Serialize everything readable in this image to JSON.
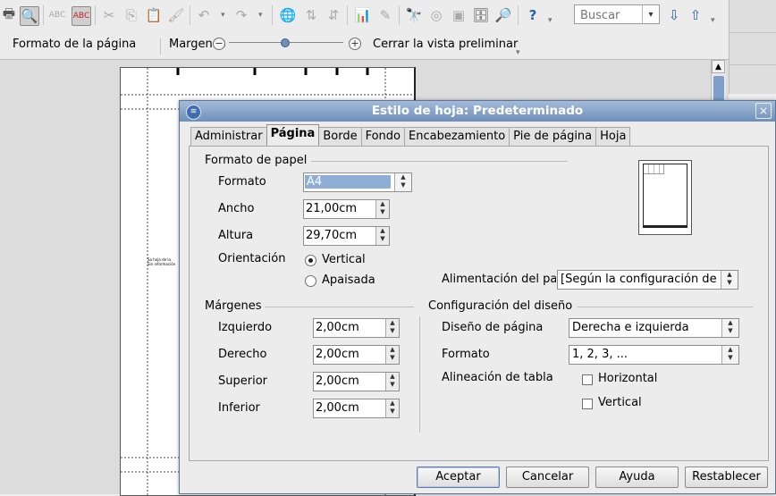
{
  "toolbar": {
    "search_placeholder": "Buscar",
    "icons": [
      "printer-icon",
      "print-preview-icon",
      "spellcheck-icon",
      "autospellcheck-icon",
      "cut-icon",
      "copy-icon",
      "paste-icon",
      "clone-format-icon",
      "undo-icon",
      "redo-icon",
      "hyperlink-icon",
      "sort-ascending-icon",
      "sort-descending-icon",
      "chart-icon",
      "draw-functions-icon",
      "find-replace-icon",
      "navigator-icon",
      "gallery-icon",
      "data-sources-icon",
      "zoom-icon",
      "help-icon",
      "find-next-icon",
      "find-previous-icon"
    ]
  },
  "preview_bar": {
    "format_page": "Formato de la página",
    "margins": "Margenes",
    "close_preview": "Cerrar la vista preliminar",
    "zoom_minus": "−",
    "zoom_plus": "+"
  },
  "document": {
    "cell_text_1": "Sa hoja de la",
    "cell_text_2": "Sin información"
  },
  "dialog": {
    "title": "Estilo de hoja: Predeterminado",
    "close": "×",
    "tabs": [
      "Administrar",
      "Página",
      "Borde",
      "Fondo",
      "Encabezamiento",
      "Pie de página",
      "Hoja"
    ],
    "active_tab": "Página",
    "paper_format": {
      "section": "Formato de papel",
      "format_label": "Formato",
      "format_value": "A4",
      "width_label": "Ancho",
      "width_value": "21,00cm",
      "height_label": "Altura",
      "height_value": "29,70cm",
      "orientation_label": "Orientación",
      "orientation_vertical": "Vertical",
      "orientation_landscape": "Apaisada",
      "paper_tray_label": "Alimentación del papel",
      "paper_tray_value": "[Según la configuración de la impresora]"
    },
    "margins": {
      "section": "Márgenes",
      "left_label": "Izquierdo",
      "left_value": "2,00cm",
      "right_label": "Derecho",
      "right_value": "2,00cm",
      "top_label": "Superior",
      "top_value": "2,00cm",
      "bottom_label": "Inferior",
      "bottom_value": "2,00cm"
    },
    "layout": {
      "section": "Configuración del diseño",
      "page_layout_label": "Diseño de página",
      "page_layout_value": "Derecha e izquierda",
      "format_label": "Formato",
      "format_value": "1, 2, 3, ...",
      "table_align_label": "Alineación de tabla",
      "horizontal": "Horizontal",
      "vertical": "Vertical"
    },
    "buttons": {
      "ok": "Aceptar",
      "cancel": "Cancelar",
      "help": "Ayuda",
      "reset": "Restablecer"
    }
  }
}
